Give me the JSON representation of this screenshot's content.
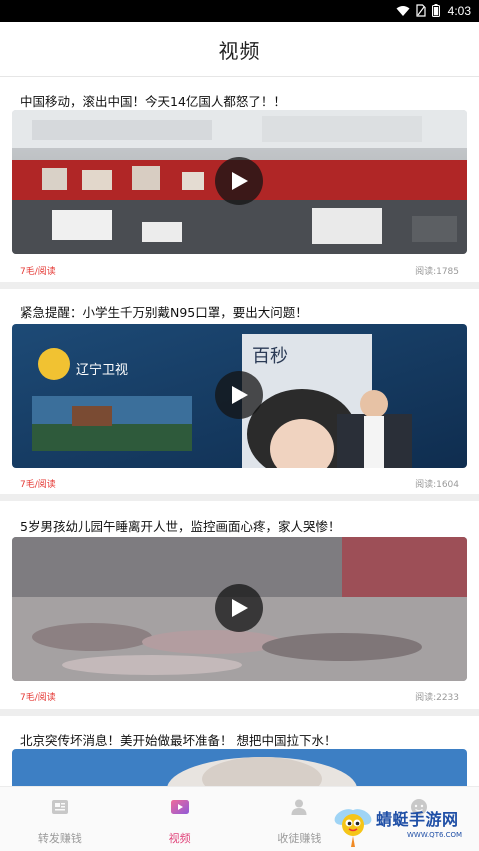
{
  "status_bar": {
    "time": "4:03"
  },
  "header": {
    "title": "视频"
  },
  "feed": [
    {
      "title": "中国移动，滚出中国！今天14亿国人都怒了！！",
      "reward": "7毛/阅读",
      "reads": "阅读:1785"
    },
    {
      "title": "紧急提醒：小学生千万别戴N95口罩，要出大问题！",
      "reward": "7毛/阅读",
      "reads": "阅读:1604"
    },
    {
      "title": "5岁男孩幼儿园午睡离开人世，监控画面心疼，家人哭惨！",
      "reward": "7毛/阅读",
      "reads": "阅读:2233"
    },
    {
      "title": "北京突传坏消息！美开始做最坏准备！ 想把中国拉下水！"
    }
  ],
  "tabbar": {
    "items": [
      {
        "label": "转发赚钱",
        "icon": "news-icon",
        "active": false
      },
      {
        "label": "视频",
        "icon": "video-icon",
        "active": true
      },
      {
        "label": "收徒赚钱",
        "icon": "user-icon",
        "active": false
      },
      {
        "label": "",
        "icon": "face-icon",
        "active": false
      }
    ]
  },
  "watermark": {
    "text": "蜻蜓手游网",
    "sub": "WWW.QT6.COM"
  },
  "colors": {
    "accent": "#e0457b",
    "reward": "#e53935",
    "watermark": "#1f4fa6"
  }
}
